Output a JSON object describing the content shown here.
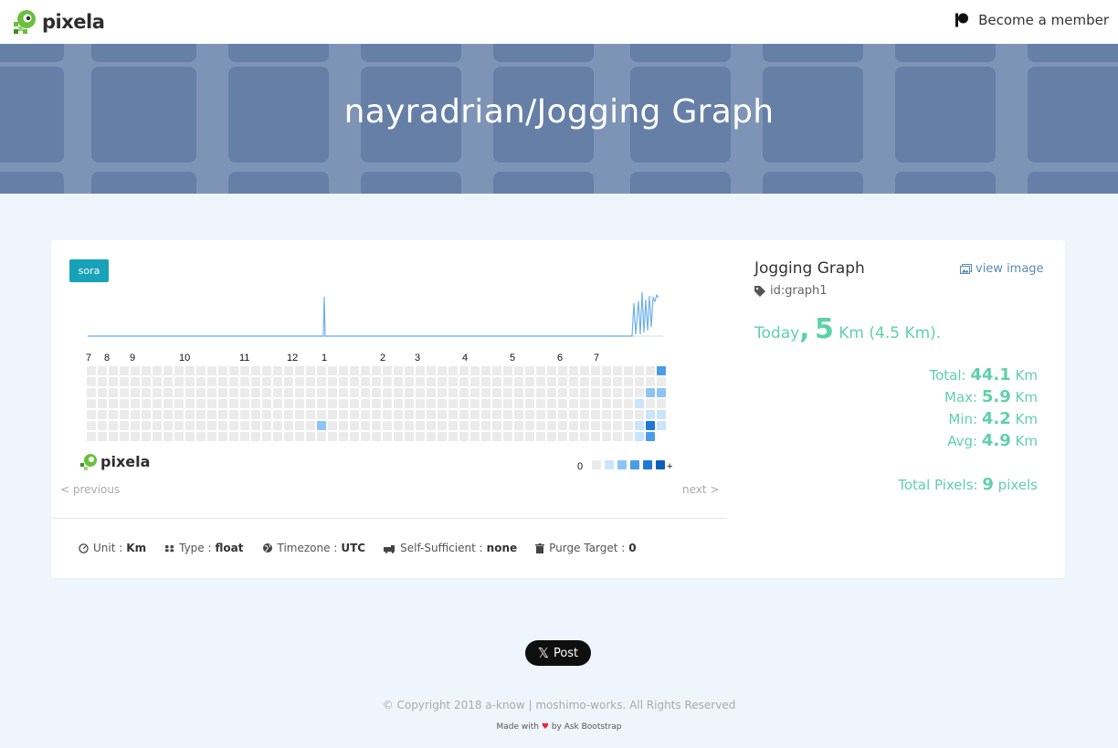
{
  "navbar": {
    "brand": "pixela",
    "member_label": "Become a member"
  },
  "hero": {
    "title": "nayradrian/Jogging Graph"
  },
  "graph": {
    "badge": "sora",
    "months": [
      "7",
      "8",
      "9",
      "10",
      "11",
      "12",
      "1",
      "2",
      "3",
      "4",
      "5",
      "6",
      "7"
    ],
    "watermark": "pixela",
    "legend_zero": "0",
    "legend_plus": "+",
    "legend_colors": [
      "#ebebeb",
      "#c9e4fb",
      "#8cc4f5",
      "#4a9ce8",
      "#1f77d8",
      "#0f5fb8"
    ],
    "cell_colors": {
      "empty": "#ebebeb",
      "level1": "#c9e4fb",
      "level2": "#8cc4f5",
      "level3": "#4a9ce8",
      "level4": "#1f77d8",
      "level5": "#0f5fb8"
    },
    "line_color": "#6fb0ec",
    "prev_label": "< previous",
    "next_label": "next >"
  },
  "meta": {
    "unit_label": "Unit :",
    "unit_value": "Km",
    "type_label": "Type :",
    "type_value": "float",
    "timezone_label": "Timezone :",
    "timezone_value": "UTC",
    "selfsufficient_label": "Self-Sufficient :",
    "selfsufficient_value": "none",
    "purge_label": "Purge Target :",
    "purge_value": "0"
  },
  "info": {
    "title": "Jogging Graph",
    "view_image": "view image",
    "id": "id:graph1",
    "today_prefix": "Today",
    "today_sep": ",",
    "today_value": "5",
    "today_unit": "Km",
    "today_extra": "(4.5 Km).",
    "total_label": "Total:",
    "total_value": "44.1",
    "max_label": "Max:",
    "max_value": "5.9",
    "min_label": "Min:",
    "min_value": "4.2",
    "avg_label": "Avg:",
    "avg_value": "4.9",
    "unit": "Km",
    "pixels_label": "Total Pixels:",
    "pixels_value": "9",
    "pixels_unit": "pixels"
  },
  "footer": {
    "post_label": "Post",
    "copyright": "© Copyright 2018 a-know | moshimo-works. All Rights Reserved",
    "made_prefix": "Made with",
    "made_suffix": "by Ask Bootstrap"
  }
}
